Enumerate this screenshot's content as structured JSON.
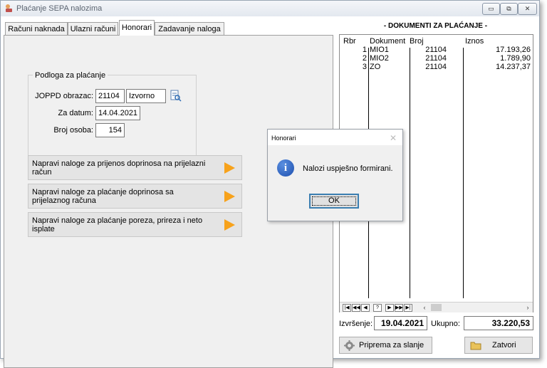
{
  "window": {
    "title": "Plaćanje SEPA nalozima",
    "controls": {
      "minimize": "▭",
      "restore": "⧉",
      "close": "✕"
    }
  },
  "tabs": [
    {
      "label": "Računi naknada",
      "active": false
    },
    {
      "label": "Ulazni računi",
      "active": false
    },
    {
      "label": "Honorari",
      "active": true
    },
    {
      "label": "Zadavanje naloga",
      "active": false
    }
  ],
  "form": {
    "group_title": "Podloga za plaćanje",
    "joppd_label": "JOPPD obrazac:",
    "joppd_value": "21104",
    "joppd_type": "Izvorno",
    "date_label": "Za datum:",
    "date_value": "14.04.2021",
    "persons_label": "Broj osoba:",
    "persons_value": "154"
  },
  "actions": [
    {
      "label": "Napravi naloge za prijenos doprinosa na prijelazni račun"
    },
    {
      "label": "Napravi naloge za plaćanje doprinosa sa prijelaznog računa"
    },
    {
      "label": "Napravi naloge za plaćanje poreza, prireza i neto isplate"
    }
  ],
  "documents": {
    "title": "- DOKUMENTI ZA PLAĆANJE -",
    "columns": [
      "Rbr",
      "Dokument",
      "Broj",
      "Iznos"
    ],
    "rows": [
      {
        "rbr": "1",
        "dokument": "MIO1",
        "broj": "21104",
        "iznos": "17.193,26"
      },
      {
        "rbr": "2",
        "dokument": "MIO2",
        "broj": "21104",
        "iznos": "1.789,90"
      },
      {
        "rbr": "3",
        "dokument": "ZO",
        "broj": "21104",
        "iznos": "14.237,37"
      }
    ],
    "nav": [
      "|◀",
      "◀◀",
      "◀",
      "?",
      "▶",
      "▶▶",
      "▶|"
    ]
  },
  "footer": {
    "execution_label": "Izvršenje:",
    "execution_date": "19.04.2021",
    "total_label": "Ukupno:",
    "total_value": "33.220,53",
    "prepare_button": "Priprema za slanje",
    "close_button": "Zatvori"
  },
  "dialog": {
    "title": "Honorari",
    "message": "Nalozi uspješno formirani.",
    "ok_label": "OK"
  },
  "colors": {
    "arrow": "#f7a21b",
    "focus_border": "#3c7fb1",
    "info_icon": "#1d4fae"
  }
}
